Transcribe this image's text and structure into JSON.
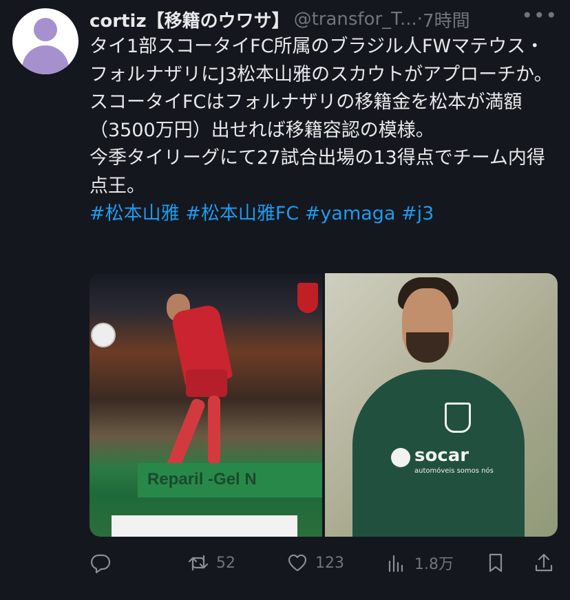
{
  "tweet": {
    "author": "cortiz【移籍のウワサ】",
    "handle": "@transfor_T...",
    "separator": "·",
    "time": "7時間",
    "more_icon": "more-icon",
    "paragraphs": [
      "タイ1部スコータイFC所属のブラジル人FWマテウス・フォルナザリにJ3松本山雅のスカウトがアプローチか。",
      "スコータイFCはフォルナザリの移籍金を松本が満額（3500万円）出せれば移籍容認の模様。",
      "今季タイリーグにて27試合出場の13得点でチーム内得点王。"
    ],
    "hashtags": "#松本山雅 #松本山雅FC #yamaga #j3",
    "media": {
      "left_banner": "Reparil -Gel N",
      "right_sponsor": "socar",
      "right_sponsor_sub": "automóveis somos nós"
    },
    "actions": {
      "reply_count": "",
      "retweet_count": "52",
      "like_count": "123",
      "view_count": "1.8万"
    },
    "colors": {
      "background": "#14171d",
      "text": "#e7e9ea",
      "secondary": "#71767b",
      "link": "#1d9bf0"
    }
  }
}
